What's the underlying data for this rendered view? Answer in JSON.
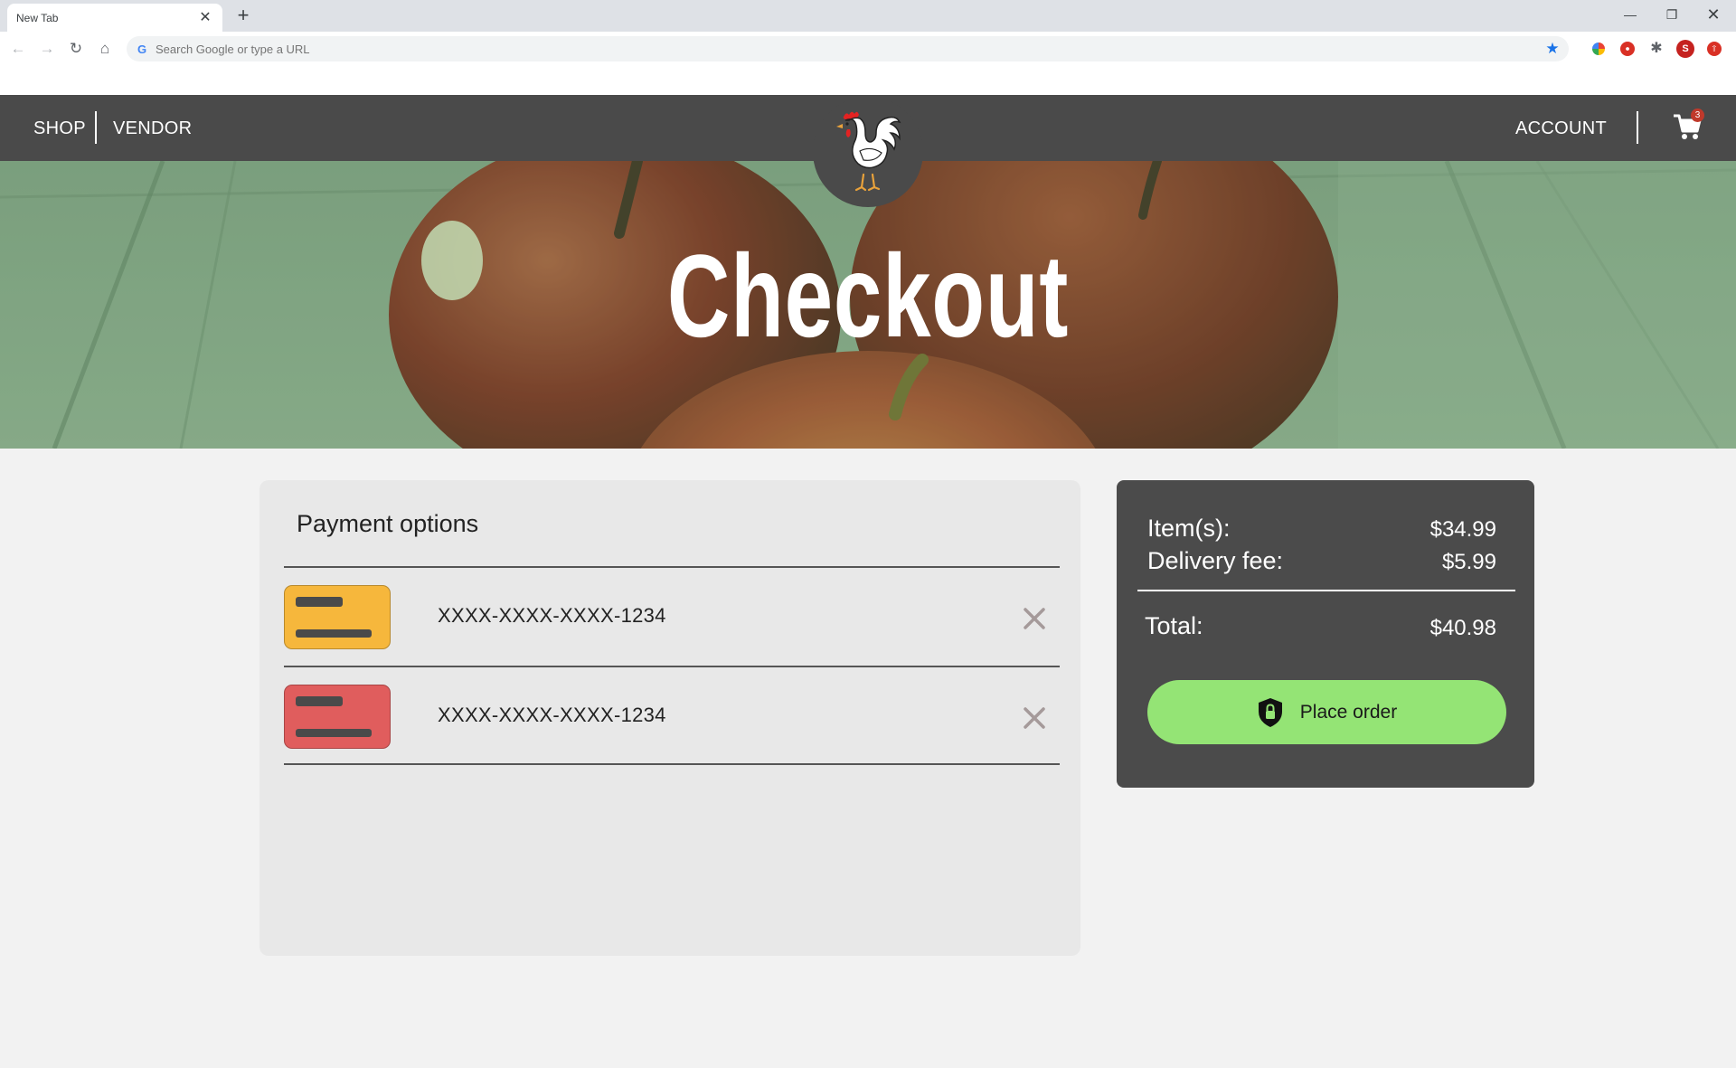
{
  "browser": {
    "tab_title": "New Tab",
    "tab_close": "✕",
    "new_tab": "+",
    "omnibox_placeholder": "Search Google or type a URL",
    "profile_initial": "S"
  },
  "header": {
    "nav": [
      {
        "label": "SHOP"
      },
      {
        "label": "VENDOR"
      }
    ],
    "account_label": "ACCOUNT",
    "cart_count": "3"
  },
  "hero": {
    "title": "Checkout"
  },
  "payment": {
    "title": "Payment options",
    "cards": [
      {
        "number": "XXXX-XXXX-XXXX-1234",
        "color": "#f6b73c"
      },
      {
        "number": "XXXX-XXXX-XXXX-1234",
        "color": "#e05d5d"
      }
    ]
  },
  "summary": {
    "items_label": "Item(s):",
    "items_value": "$34.99",
    "delivery_label": "Delivery fee:",
    "delivery_value": "$5.99",
    "total_label": "Total:",
    "total_value": "$40.98",
    "place_order_label": "Place order"
  },
  "colors": {
    "header_bg": "#4a4a4a",
    "page_bg": "#f2f2f2",
    "panel_bg": "#e8e8e8",
    "summary_bg": "#4b4b4b",
    "accent_green": "#94e475"
  }
}
